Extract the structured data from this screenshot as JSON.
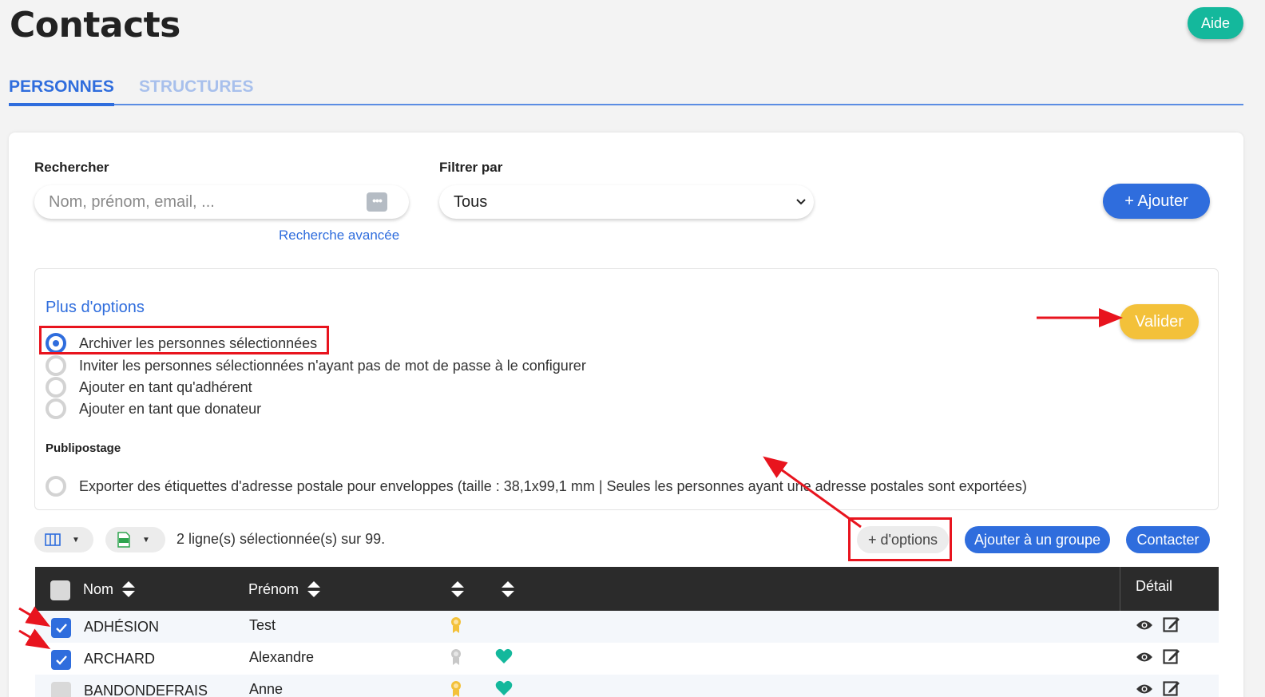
{
  "header": {
    "title": "Contacts",
    "help_label": "Aide"
  },
  "tabs": [
    {
      "label": "PERSONNES",
      "active": true
    },
    {
      "label": "STRUCTURES",
      "active": false
    }
  ],
  "search": {
    "label": "Rechercher",
    "placeholder": "Nom, prénom, email, ...",
    "value": "",
    "advanced_link": "Recherche avancée"
  },
  "filter": {
    "label": "Filtrer par",
    "selected": "Tous"
  },
  "add_button": "+ Ajouter",
  "options": {
    "title": "Plus d'options",
    "radios": [
      {
        "label": "Archiver les personnes sélectionnées",
        "checked": true
      },
      {
        "label": "Inviter les personnes sélectionnées n'ayant pas de mot de passe à le configurer",
        "checked": false
      },
      {
        "label": "Ajouter en tant qu'adhérent",
        "checked": false
      },
      {
        "label": "Ajouter en tant que donateur",
        "checked": false
      }
    ],
    "publipostage_label": "Publipostage",
    "publipostage_radio": {
      "label": "Exporter des étiquettes d'adresse postale pour enveloppes (taille : 38,1x99,1 mm | Seules les personnes ayant une adresse postales sont exportées)",
      "checked": false
    },
    "validate_label": "Valider"
  },
  "toolbar": {
    "selection_text": "2 ligne(s) sélectionnée(s) sur 99.",
    "more_options_label": "+ d'options",
    "add_group_label": "Ajouter à un groupe",
    "contact_label": "Contacter"
  },
  "table": {
    "headers": {
      "nom": "Nom",
      "prenom": "Prénom",
      "detail": "Détail"
    },
    "rows": [
      {
        "nom": "ADHÉSION",
        "prenom": "Test",
        "checked": true,
        "medal": "gold",
        "heart": false
      },
      {
        "nom": "ARCHARD",
        "prenom": "Alexandre",
        "checked": true,
        "medal": "grey",
        "heart": true
      },
      {
        "nom": "BANDONDEFRAIS",
        "prenom": "Anne",
        "checked": false,
        "medal": "gold",
        "heart": true
      }
    ]
  },
  "colors": {
    "primary": "#2f6ddd",
    "help": "#14b89c",
    "validate": "#f3c13a",
    "annotation": "#e8141e",
    "heart": "#14b89c",
    "medal_gold": "#f3c13a",
    "medal_grey": "#c8c8c8"
  }
}
